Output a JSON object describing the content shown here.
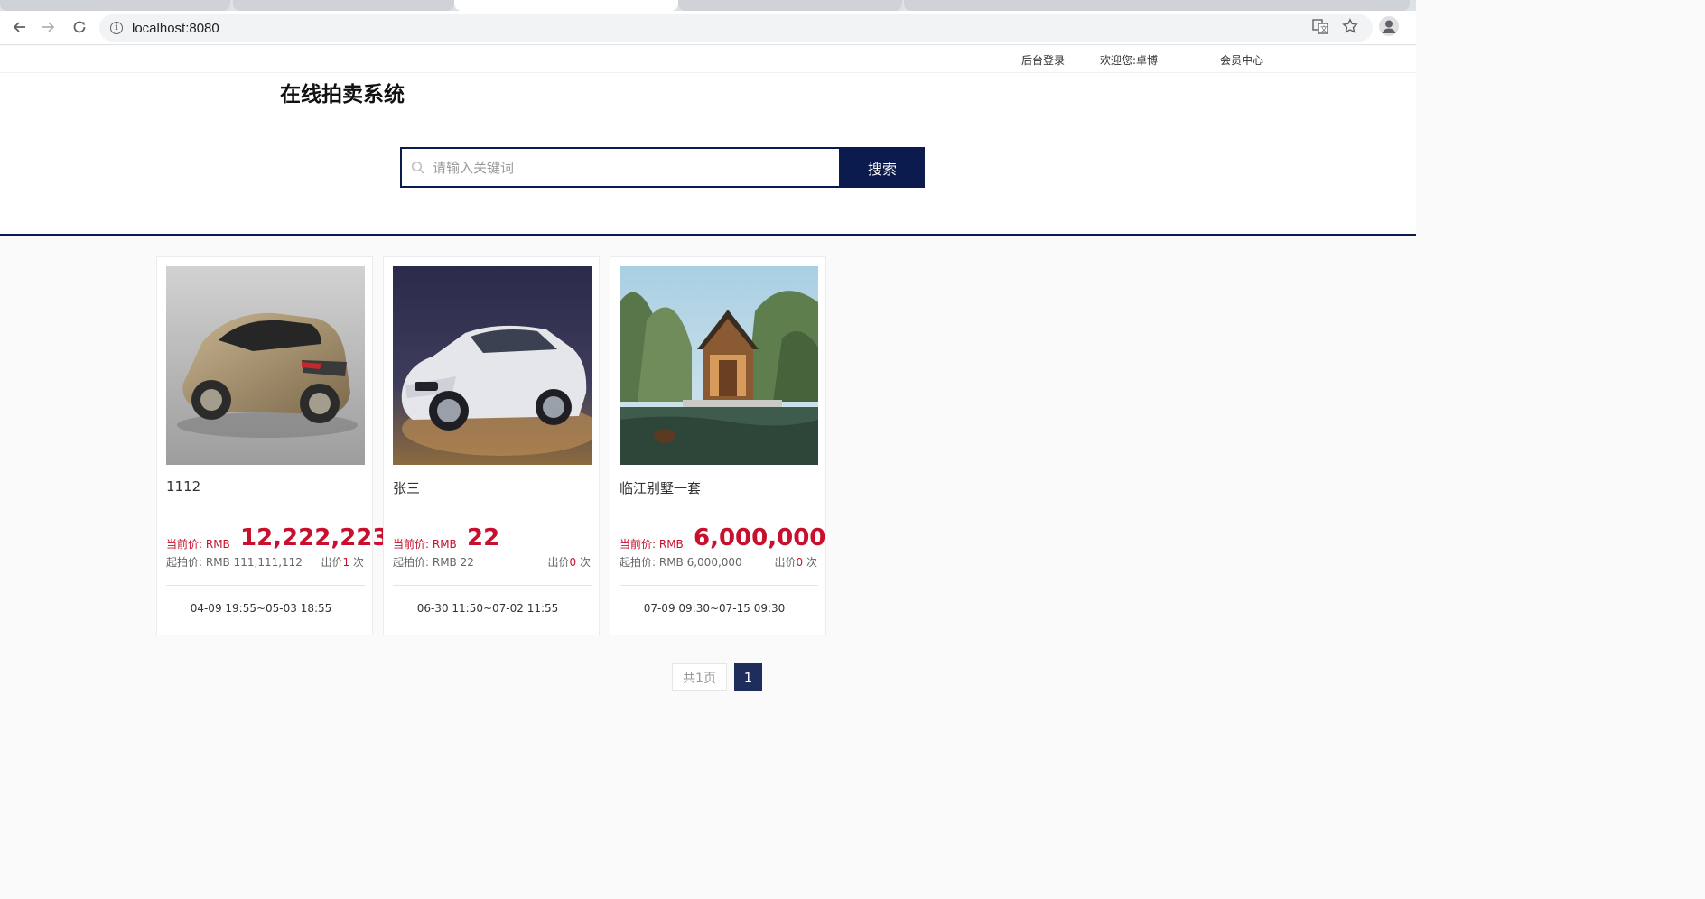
{
  "browser": {
    "url": "localhost:8080"
  },
  "topbar": {
    "admin_login": "后台登录",
    "welcome": "欢迎您:卓博",
    "member_center": "会员中心"
  },
  "header": {
    "site_title": "在线拍卖系统",
    "search_placeholder": "请输入关键词",
    "search_button": "搜索"
  },
  "items": [
    {
      "name": "1112",
      "current_label": "当前价:  RMB",
      "current_price": "12,222,223",
      "start_price": "起拍价:  RMB 111,111,112",
      "bids_prefix": "出价",
      "bids_count": "1",
      "bids_suffix": " 次",
      "time": "04-09 19:55~05-03 18:55"
    },
    {
      "name": "张三",
      "current_label": "当前价:  RMB",
      "current_price": "22",
      "start_price": "起拍价:  RMB 22",
      "bids_prefix": "出价",
      "bids_count": "0",
      "bids_suffix": " 次",
      "time": "06-30 11:50~07-02 11:55"
    },
    {
      "name": "临江别墅一套",
      "current_label": "当前价:  RMB",
      "current_price": "6,000,000",
      "start_price": "起拍价:  RMB 6,000,000",
      "bids_prefix": "出价",
      "bids_count": "0",
      "bids_suffix": " 次",
      "time": "07-09 09:30~07-15 09:30"
    }
  ],
  "pagination": {
    "total": "共1页",
    "current": "1"
  },
  "colors": {
    "brand": "#0c1b4d",
    "price": "#c8102e"
  }
}
